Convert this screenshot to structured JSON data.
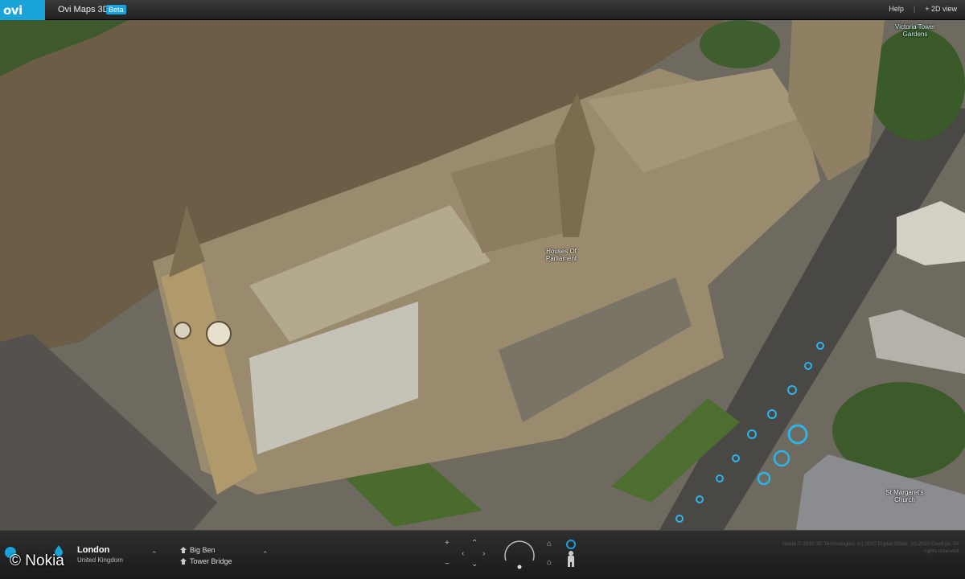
{
  "app": {
    "logo": "ovi",
    "title": "Ovi Maps 3D",
    "badge": "Beta"
  },
  "top_links": {
    "help": "Help",
    "view_toggle": "+ 2D view"
  },
  "map": {
    "labels": {
      "parliament": "Houses Of Parliament",
      "church": "St Margaret's Church",
      "gardens": "Victoria Tower Gardens"
    }
  },
  "location": {
    "city": "London",
    "country": "United Kingdom"
  },
  "pois": [
    {
      "label": "Big Ben",
      "icon": "landmark-pin-icon"
    },
    {
      "label": "Tower Bridge",
      "icon": "landmark-pin-icon"
    }
  ],
  "attribution": "Nokia © 2010 3D Technologies, (c) 2010 Digital Globe, (c) 2010 GeoEye, All rights reserved",
  "watermark": "© Nokia",
  "colors": {
    "accent": "#19a3d9",
    "river": "#6a5c45",
    "grass": "#4a6a2e",
    "stone": "#a89a7c"
  }
}
